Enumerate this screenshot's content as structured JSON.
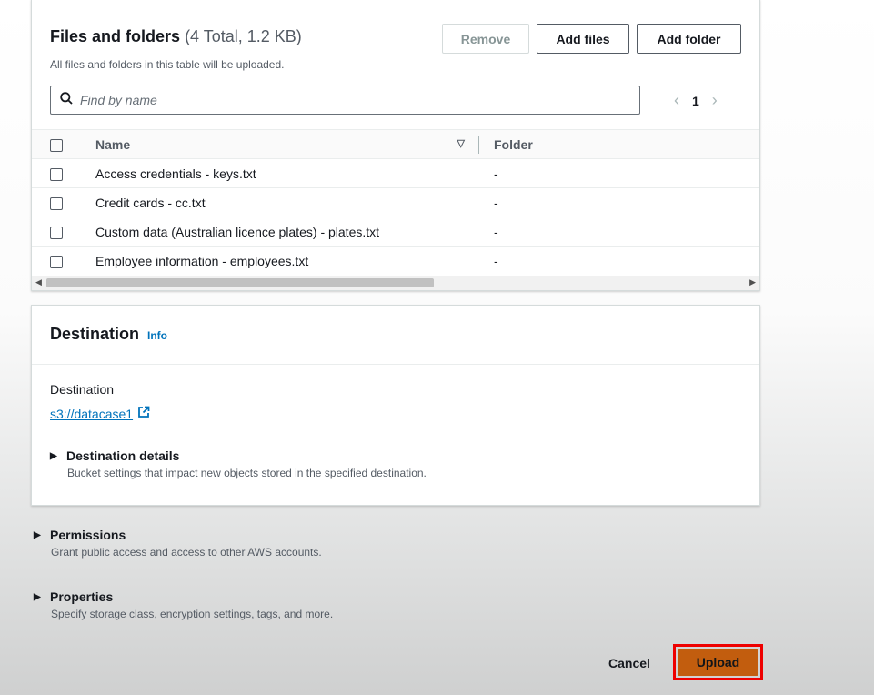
{
  "files_card": {
    "title": "Files and folders",
    "count": "(4 Total, 1.2 KB)",
    "description": "All files and folders in this table will be uploaded.",
    "remove_label": "Remove",
    "add_files_label": "Add files",
    "add_folder_label": "Add folder",
    "search_placeholder": "Find by name",
    "page_number": "1",
    "columns": {
      "name": "Name",
      "folder": "Folder"
    },
    "rows": [
      {
        "name": "Access credentials - keys.txt",
        "folder": "-"
      },
      {
        "name": "Credit cards - cc.txt",
        "folder": "-"
      },
      {
        "name": "Custom data (Australian licence plates) - plates.txt",
        "folder": "-"
      },
      {
        "name": "Employee information - employees.txt",
        "folder": "-"
      }
    ]
  },
  "destination_card": {
    "title": "Destination",
    "info_label": "Info",
    "field_label": "Destination",
    "link": "s3://datacase1",
    "details_title": "Destination details",
    "details_desc": "Bucket settings that impact new objects stored in the specified destination."
  },
  "permissions": {
    "title": "Permissions",
    "desc": "Grant public access and access to other AWS accounts."
  },
  "properties": {
    "title": "Properties",
    "desc": "Specify storage class, encryption settings, tags, and more."
  },
  "footer": {
    "cancel_label": "Cancel",
    "upload_label": "Upload"
  },
  "colors": {
    "accent": "#ec7211",
    "link": "#0073bb",
    "highlight": "#ee0000"
  }
}
